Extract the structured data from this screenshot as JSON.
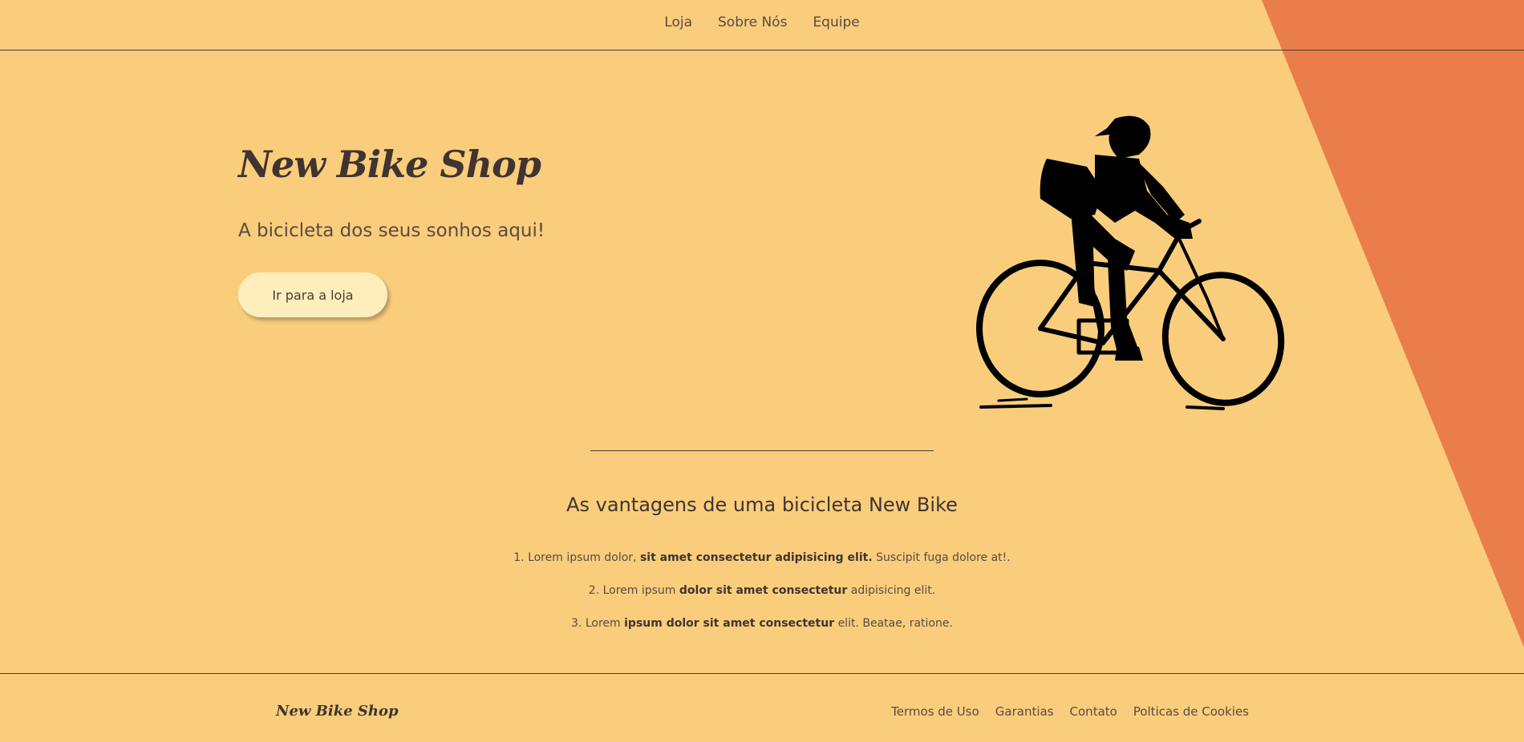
{
  "nav": {
    "items": [
      {
        "label": "Loja"
      },
      {
        "label": "Sobre Nós"
      },
      {
        "label": "Equipe"
      }
    ]
  },
  "hero": {
    "title": "New Bike Shop",
    "subtitle": "A bicicleta dos seus sonhos aqui!",
    "cta_label": "Ir para a loja"
  },
  "advantages": {
    "title": "As vantagens de uma bicicleta New Bike",
    "items": [
      {
        "num": "1.",
        "pre": "Lorem ipsum dolor,",
        "bold": "sit amet consectetur adipisicing elit.",
        "post": "Suscipit fuga dolore at!."
      },
      {
        "num": "2.",
        "pre": "Lorem ipsum",
        "bold": "dolor sit amet consectetur",
        "post": "adipisicing elit."
      },
      {
        "num": "3.",
        "pre": "Lorem",
        "bold": "ipsum dolor sit amet consectetur",
        "post": "elit. Beatae, ratione."
      }
    ]
  },
  "footer": {
    "brand": "New Bike Shop",
    "links": [
      {
        "label": "Termos de Uso"
      },
      {
        "label": "Garantias"
      },
      {
        "label": "Contato"
      },
      {
        "label": "Polticas de Cookies"
      }
    ]
  },
  "colors": {
    "background": "#facd7c",
    "accent_stripe": "#e97e4a",
    "button": "#fdeebc",
    "text": "#4a3b35"
  },
  "icons": {
    "hero_image": "cyclist-illustration"
  }
}
